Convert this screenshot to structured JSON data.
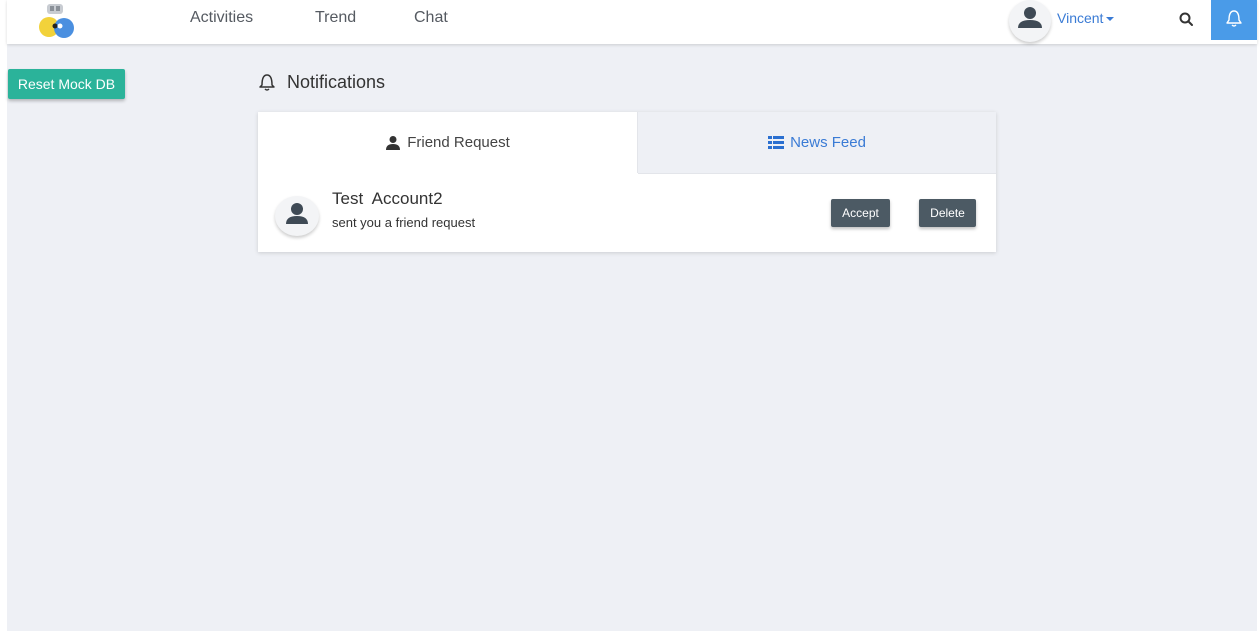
{
  "header": {
    "nav": [
      "Activities",
      "Trend",
      "Chat"
    ],
    "user": "Vincent"
  },
  "sidebar": {
    "reset_label": "Reset Mock DB"
  },
  "notifications": {
    "title": "Notifications",
    "tabs": [
      {
        "label": "Friend Request",
        "icon": "user-icon",
        "active": true
      },
      {
        "label": "News Feed",
        "icon": "list-icon",
        "active": false
      }
    ],
    "requests": [
      {
        "name": "Test  Account2",
        "message": "sent you a friend request",
        "accept": "Accept",
        "delete": "Delete"
      }
    ]
  },
  "colors": {
    "accent_blue": "#3a7bd5",
    "bell_bg": "#4a9be8",
    "reset_green": "#2bb39a",
    "action_dark": "#4c5a64"
  }
}
